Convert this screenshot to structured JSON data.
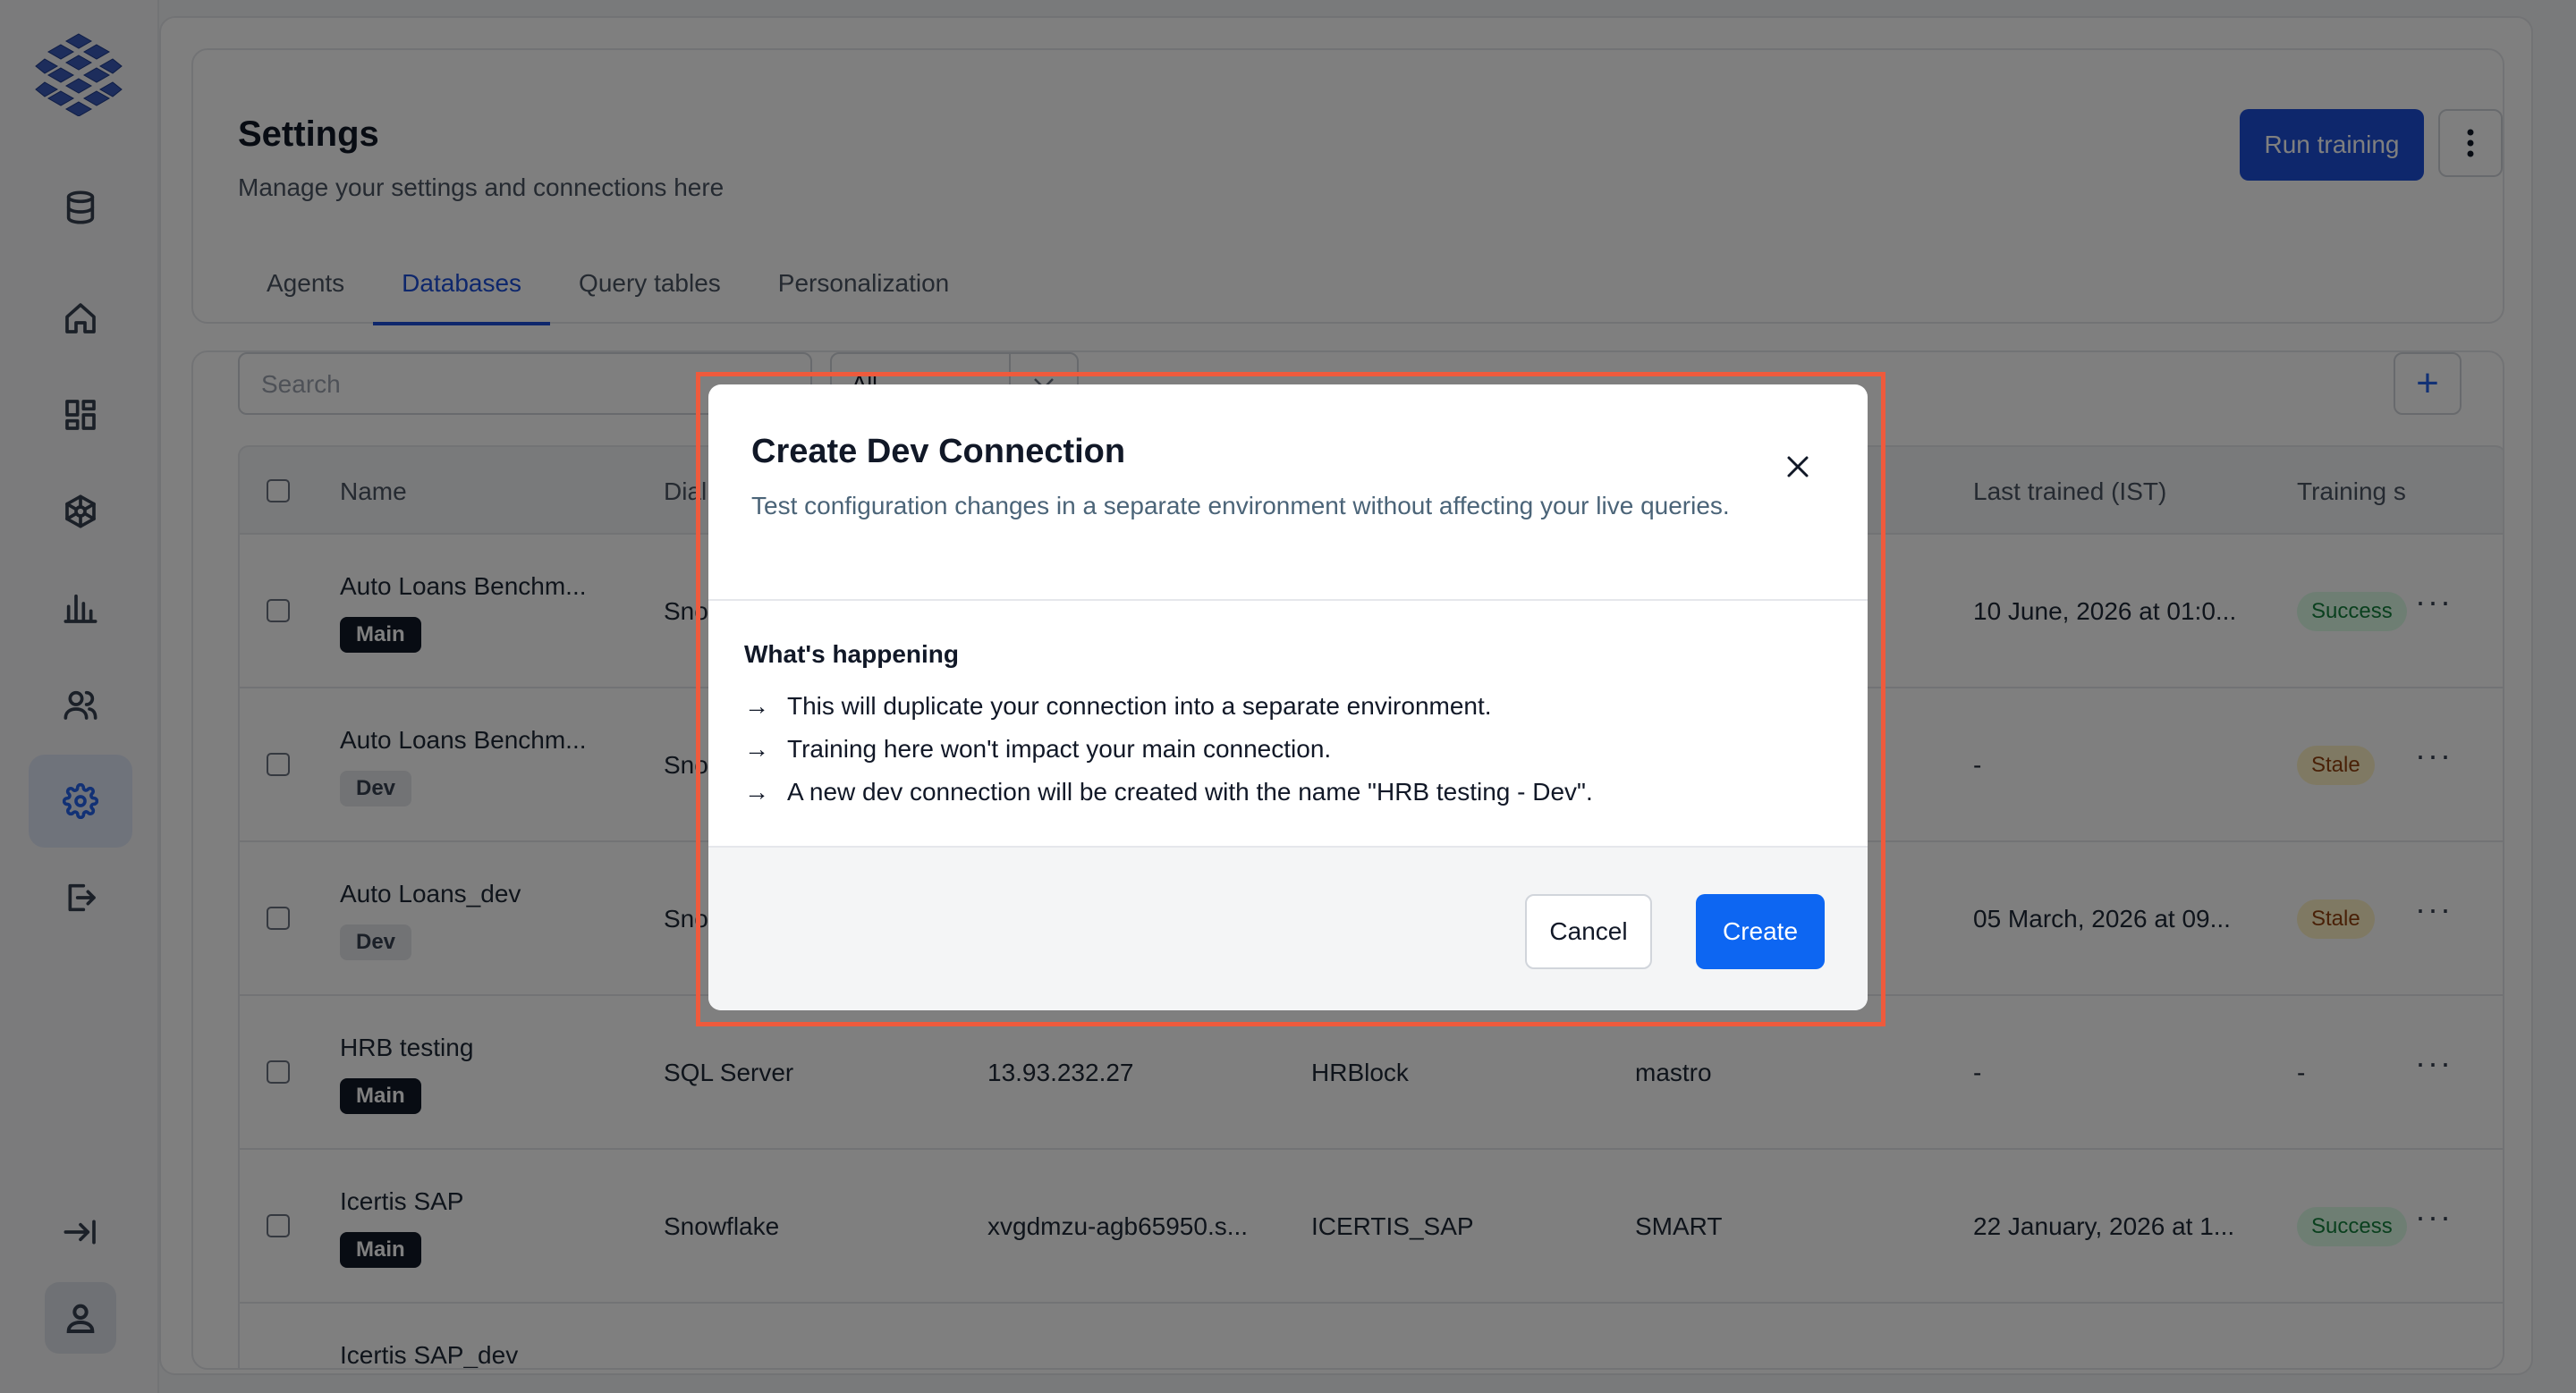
{
  "header": {
    "title": "Settings",
    "subtitle": "Manage your settings and connections here",
    "run_training": "Run training"
  },
  "tabs": [
    {
      "label": "Agents"
    },
    {
      "label": "Databases"
    },
    {
      "label": "Query tables"
    },
    {
      "label": "Personalization"
    }
  ],
  "active_tab": "Databases",
  "toolbar": {
    "search_placeholder": "Search",
    "filter_value": "All"
  },
  "table": {
    "columns": [
      "Name",
      "Dial",
      "Last trained (IST)",
      "Training s"
    ],
    "rows": [
      {
        "name": "Auto Loans Benchm...",
        "env": "Main",
        "dialect": "Sno",
        "host": "",
        "database": "",
        "schema": "",
        "last_trained": "10 June, 2026 at 01:0...",
        "status": "Success"
      },
      {
        "name": "Auto Loans Benchm...",
        "env": "Dev",
        "dialect": "Sno",
        "host": "",
        "database": "",
        "schema": "",
        "last_trained": "-",
        "status": "Stale"
      },
      {
        "name": "Auto Loans_dev",
        "env": "Dev",
        "dialect": "Sno",
        "host": "",
        "database": "",
        "schema": "",
        "last_trained": "05 March, 2026 at 09...",
        "status": "Stale"
      },
      {
        "name": "HRB testing",
        "env": "Main",
        "dialect": "SQL Server",
        "host": "13.93.232.27",
        "database": "HRBlock",
        "schema": "mastro",
        "last_trained": "-",
        "status": "-"
      },
      {
        "name": "Icertis SAP",
        "env": "Main",
        "dialect": "Snowflake",
        "host": "xvgdmzu-agb65950.s...",
        "database": "ICERTIS_SAP",
        "schema": "SMART",
        "last_trained": "22 January, 2026 at 1...",
        "status": "Success"
      },
      {
        "name": "Icertis SAP_dev",
        "env": "",
        "dialect": "",
        "host": "",
        "database": "",
        "schema": "",
        "last_trained": "",
        "status": ""
      }
    ]
  },
  "modal": {
    "title": "Create Dev Connection",
    "description": "Test configuration changes in a separate environment without affecting your live queries.",
    "section_title": "What's happening",
    "bullets": [
      "This will duplicate your connection into a separate environment.",
      "Training here won't impact your main connection.",
      "A new dev connection will be created with the name \"HRB testing - Dev\"."
    ],
    "cancel": "Cancel",
    "create": "Create"
  },
  "colors": {
    "primary": "#1d4ed8",
    "create_button": "#0d66f2",
    "highlight_border": "#ef5a3c",
    "success": "#15803d",
    "stale": "#92400e"
  },
  "icons": [
    "logo-cubes",
    "database-icon",
    "home-icon",
    "dashboard-icon",
    "network-icon",
    "bar-chart-icon",
    "users-icon",
    "settings-icon",
    "logout-icon",
    "expand-icon",
    "user-icon"
  ]
}
